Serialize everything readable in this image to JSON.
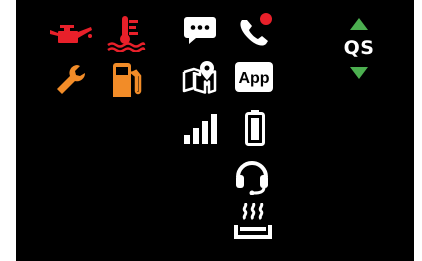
{
  "colors": {
    "background": "#000000",
    "warning_red": "#e8202a",
    "warning_orange": "#f28c28",
    "white": "#ffffff",
    "arrow_green": "#4caf50",
    "missed_call_dot": "#e8202a"
  },
  "warning_indicators": [
    {
      "icon": "oil-can-icon",
      "color": "red"
    },
    {
      "icon": "coolant-temperature-icon",
      "color": "red"
    },
    {
      "icon": "wrench-icon",
      "color": "orange"
    },
    {
      "icon": "fuel-pump-icon",
      "color": "orange"
    }
  ],
  "status_icons": [
    {
      "icon": "message-icon"
    },
    {
      "icon": "phone-icon"
    },
    {
      "icon": "map-pin-icon"
    },
    {
      "icon": "app-icon"
    },
    {
      "icon": "signal-bars-icon"
    },
    {
      "icon": "battery-icon"
    },
    {
      "icon": "headset-icon"
    },
    {
      "icon": "seat-heater-icon"
    }
  ],
  "app_label": "App",
  "quick_select": {
    "label": "QS",
    "up_icon": "triangle-up-icon",
    "down_icon": "triangle-down-icon"
  }
}
